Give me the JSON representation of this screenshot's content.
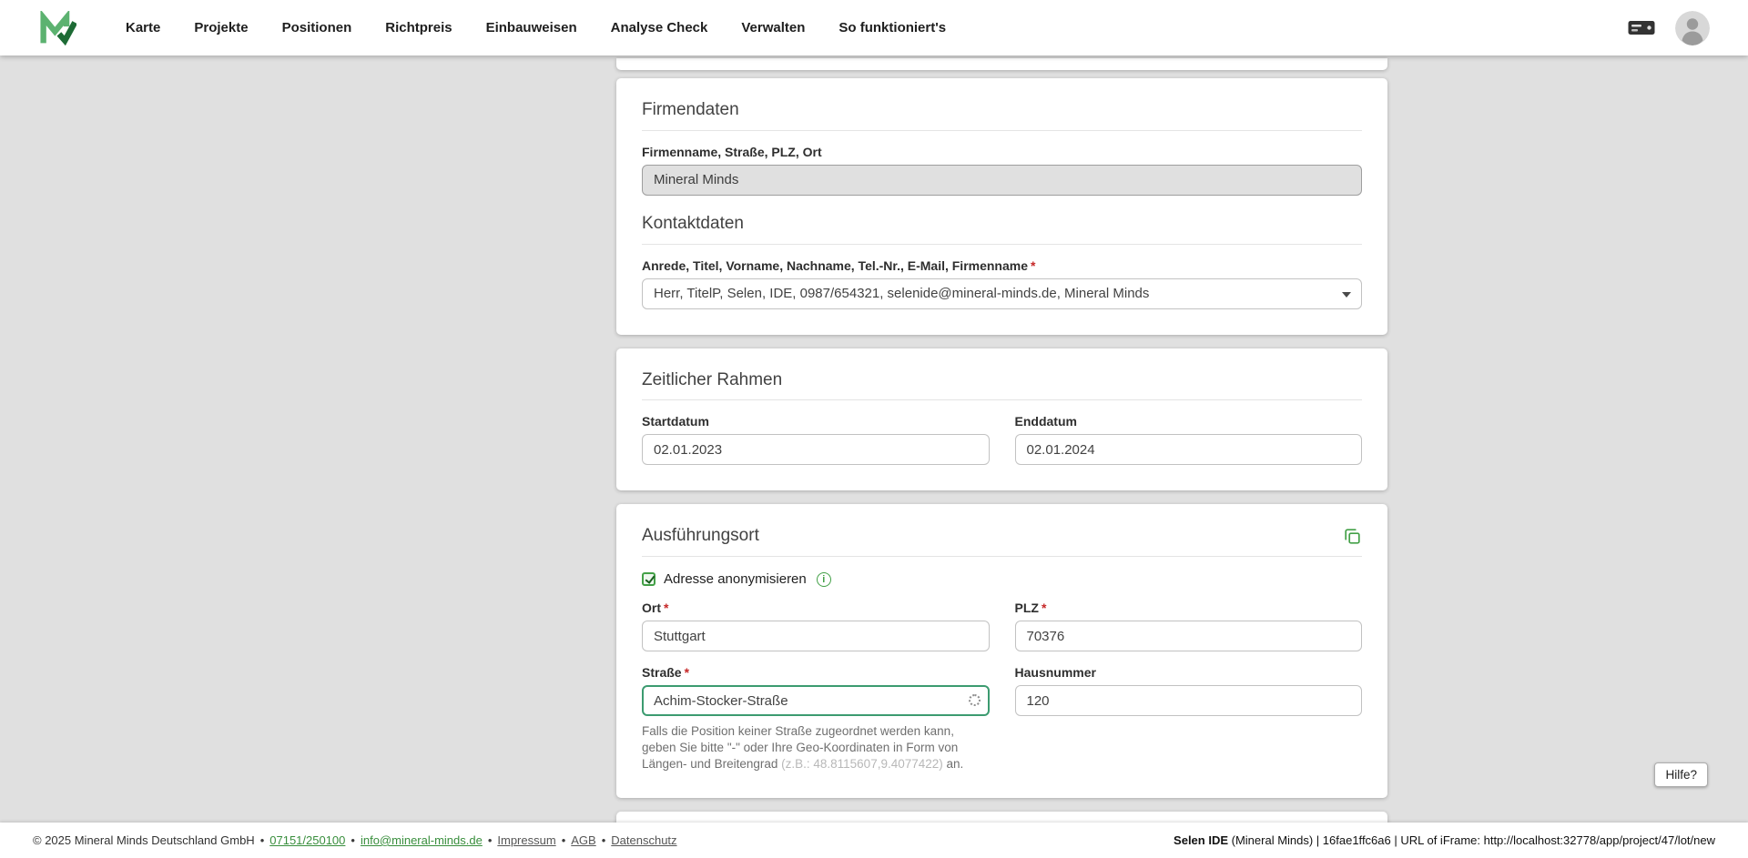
{
  "colors": {
    "accent_green": "#43a047",
    "page_background": "#e0e0e0",
    "card_background": "#ffffff",
    "required_marker_color": "#c62828",
    "focus_border": "#3c9b70",
    "link_green": "#388e3c"
  },
  "icons": {
    "logo": "mineral-minds-logo",
    "server": "server-icon",
    "avatar": "user-avatar-icon",
    "copy": "copy-icon",
    "info": "info-icon",
    "check": "check-icon",
    "chevron": "chevron-down-icon",
    "spinner": "loading-spinner-icon"
  },
  "required_marker": "*",
  "separator": "•",
  "nav": {
    "items": [
      "Karte",
      "Projekte",
      "Positionen",
      "Richtpreis",
      "Einbauweisen",
      "Analyse Check",
      "Verwalten",
      "So funktioniert's"
    ]
  },
  "cards": {
    "firmendaten": {
      "title": "Firmendaten",
      "company_label": "Firmenname, Straße, PLZ, Ort",
      "company_value": "Mineral Minds",
      "kontakt_title": "Kontaktdaten",
      "contact_label": "Anrede, Titel, Vorname, Nachname, Tel.-Nr., E-Mail, Firmenname",
      "contact_value": "Herr, TitelP, Selen, IDE, 0987/654321, selenide@mineral-minds.de, Mineral Minds"
    },
    "zeitraum": {
      "title": "Zeitlicher Rahmen",
      "start_label": "Startdatum",
      "start_value": "02.01.2023",
      "end_label": "Enddatum",
      "end_value": "02.01.2024"
    },
    "ausfuehrungsort": {
      "title": "Ausführungsort",
      "anonymize_label": "Adresse anonymisieren",
      "ort_label": "Ort",
      "ort_value": "Stuttgart",
      "plz_label": "PLZ",
      "plz_value": "70376",
      "strasse_label": "Straße",
      "strasse_value": "Achim-Stocker-Straße",
      "hausnummer_label": "Hausnummer",
      "hausnummer_value": "120",
      "hint_text": "Falls die Position keiner Straße zugeordnet werden kann, geben Sie bitte \"-\" oder Ihre Geo-Koordinaten in Form von Längen- und Breitengrad ",
      "hint_example": "(z.B.: 48.8115607,9.4077422)",
      "hint_suffix": " an."
    }
  },
  "help_button_label": "Hilfe?",
  "footer": {
    "copyright": "© 2025 Mineral Minds Deutschland GmbH",
    "phone_link": "07151/250100",
    "email_link": "info@mineral-minds.de",
    "links": [
      "Impressum",
      "AGB",
      "Datenschutz"
    ],
    "status_bold": "Selen IDE",
    "status_rest": " (Mineral Minds) | 16fae1ffc6a6 | URL of iFrame: http://localhost:32778/app/project/47/lot/new"
  }
}
